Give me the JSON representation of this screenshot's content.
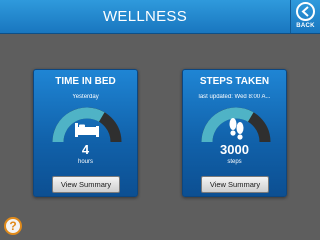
{
  "header": {
    "title": "WELLNESS",
    "back_label": "BACK"
  },
  "cards": {
    "bed": {
      "title": "TIME IN BED",
      "subtitle": "Yesterday",
      "value": "4",
      "unit": "hours",
      "button_label": "View Summary",
      "icon": "bed-icon",
      "progress_fraction": 0.67
    },
    "steps": {
      "title": "STEPS TAKEN",
      "subtitle": "last updated: Wed 8:00 A...",
      "value": "3000",
      "unit": "steps",
      "button_label": "View Summary",
      "icon": "footprints-icon",
      "progress_fraction": 0.67
    }
  },
  "help": {
    "label": "?"
  },
  "colors": {
    "header_blue": "#1f88d2",
    "card_blue": "#1162ab",
    "gauge_fill": "#4fb3c6",
    "gauge_track": "#2f2f2f",
    "background": "#5e5e5e",
    "help_orange": "#e08a1a"
  }
}
